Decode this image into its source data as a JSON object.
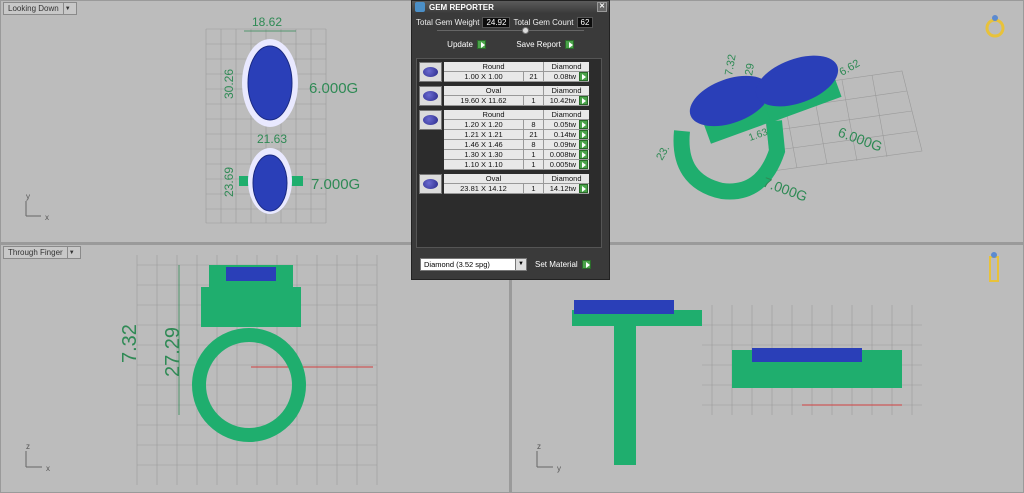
{
  "viewports": {
    "top_left": {
      "title": "Looking Down",
      "dims": [
        "18.62",
        "30.26",
        "21.63",
        "23.69"
      ],
      "weights": [
        "6.000G",
        "7.000G"
      ],
      "axes": [
        "y",
        "x"
      ]
    },
    "top_right": {
      "dims": [
        "7.32",
        "29",
        "23.",
        "1.63",
        "6.62"
      ],
      "weights": [
        "6.000G",
        "7.000G"
      ]
    },
    "bottom_left": {
      "title": "Through Finger",
      "dims": [
        "7.32",
        "27.29"
      ],
      "axes": [
        "z",
        "x"
      ]
    },
    "bottom_right": {
      "axes": [
        "z",
        "y"
      ]
    }
  },
  "gem_reporter": {
    "title": "GEM REPORTER",
    "total_weight_label": "Total Gem Weight",
    "total_weight": "24.92",
    "total_count_label": "Total Gem Count",
    "total_count": "62",
    "update_label": "Update",
    "save_label": "Save Report",
    "groups": [
      {
        "shape": "Round",
        "material": "Diamond",
        "rows": [
          [
            "1.00 X 1.00",
            "21",
            "0.08tw"
          ]
        ]
      },
      {
        "shape": "Oval",
        "material": "Diamond",
        "rows": [
          [
            "19.60 X 11.62",
            "1",
            "10.42tw"
          ]
        ]
      },
      {
        "shape": "Round",
        "material": "Diamond",
        "rows": [
          [
            "1.20 X 1.20",
            "8",
            "0.05tw"
          ],
          [
            "1.21 X 1.21",
            "21",
            "0.14tw"
          ],
          [
            "1.46 X 1.46",
            "8",
            "0.09tw"
          ],
          [
            "1.30 X 1.30",
            "1",
            "0.008tw"
          ],
          [
            "1.10 X 1.10",
            "1",
            "0.005tw"
          ]
        ]
      },
      {
        "shape": "Oval",
        "material": "Diamond",
        "rows": [
          [
            "23.81 X 14.12",
            "1",
            "14.12tw"
          ]
        ]
      }
    ],
    "material_select": "Diamond     (3.52 spg)",
    "set_material_label": "Set Material"
  },
  "colors": {
    "metal": "#1fae6e",
    "gem": "#2a3fb8",
    "dimension": "#2f8a55",
    "viewport_bg": "#bcbcbc",
    "panel_bg": "#3a3a3a"
  }
}
